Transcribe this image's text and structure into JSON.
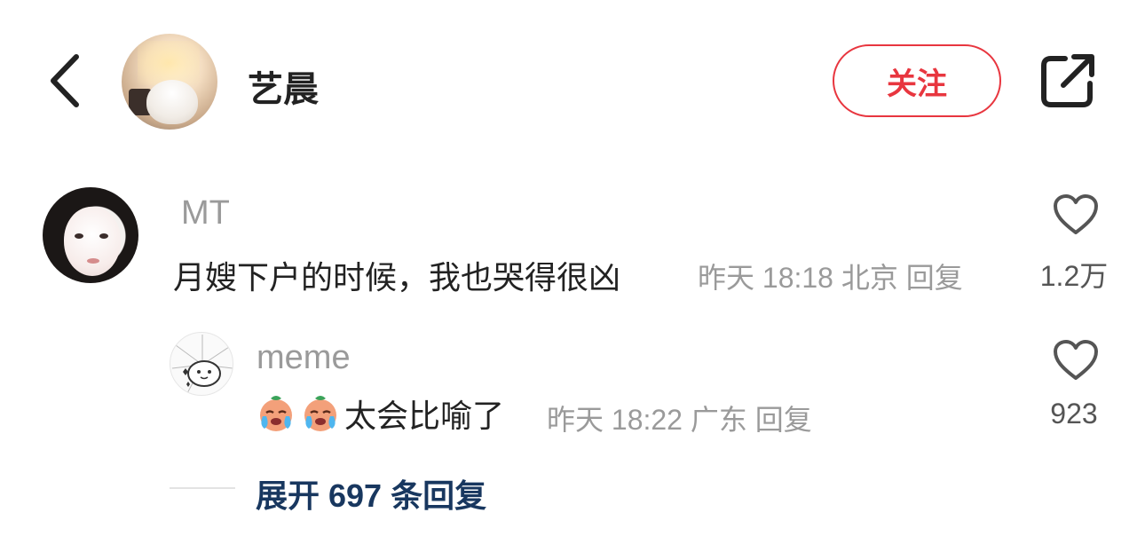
{
  "header": {
    "author_name": "艺晨",
    "follow_label": "关注",
    "icons": {
      "back": "chevron-left-icon",
      "share": "share-external-icon"
    }
  },
  "comment": {
    "username": "MT",
    "text": "月嫂下户的时候，我也哭得很凶",
    "time": "昨天 18:18",
    "location": "北京",
    "reply_label": "回复",
    "likes": "1.2万",
    "reply": {
      "username": "meme",
      "text": "太会比喻了",
      "emojis": [
        "crying-face-emoji",
        "crying-face-emoji"
      ],
      "time": "昨天 18:22",
      "location": "广东",
      "reply_label": "回复",
      "likes": "923"
    },
    "expand_label": "展开 697 条回复"
  },
  "colors": {
    "accent_red": "#e8363f",
    "link_blue": "#18375f",
    "meta_gray": "#9a9a9a"
  }
}
